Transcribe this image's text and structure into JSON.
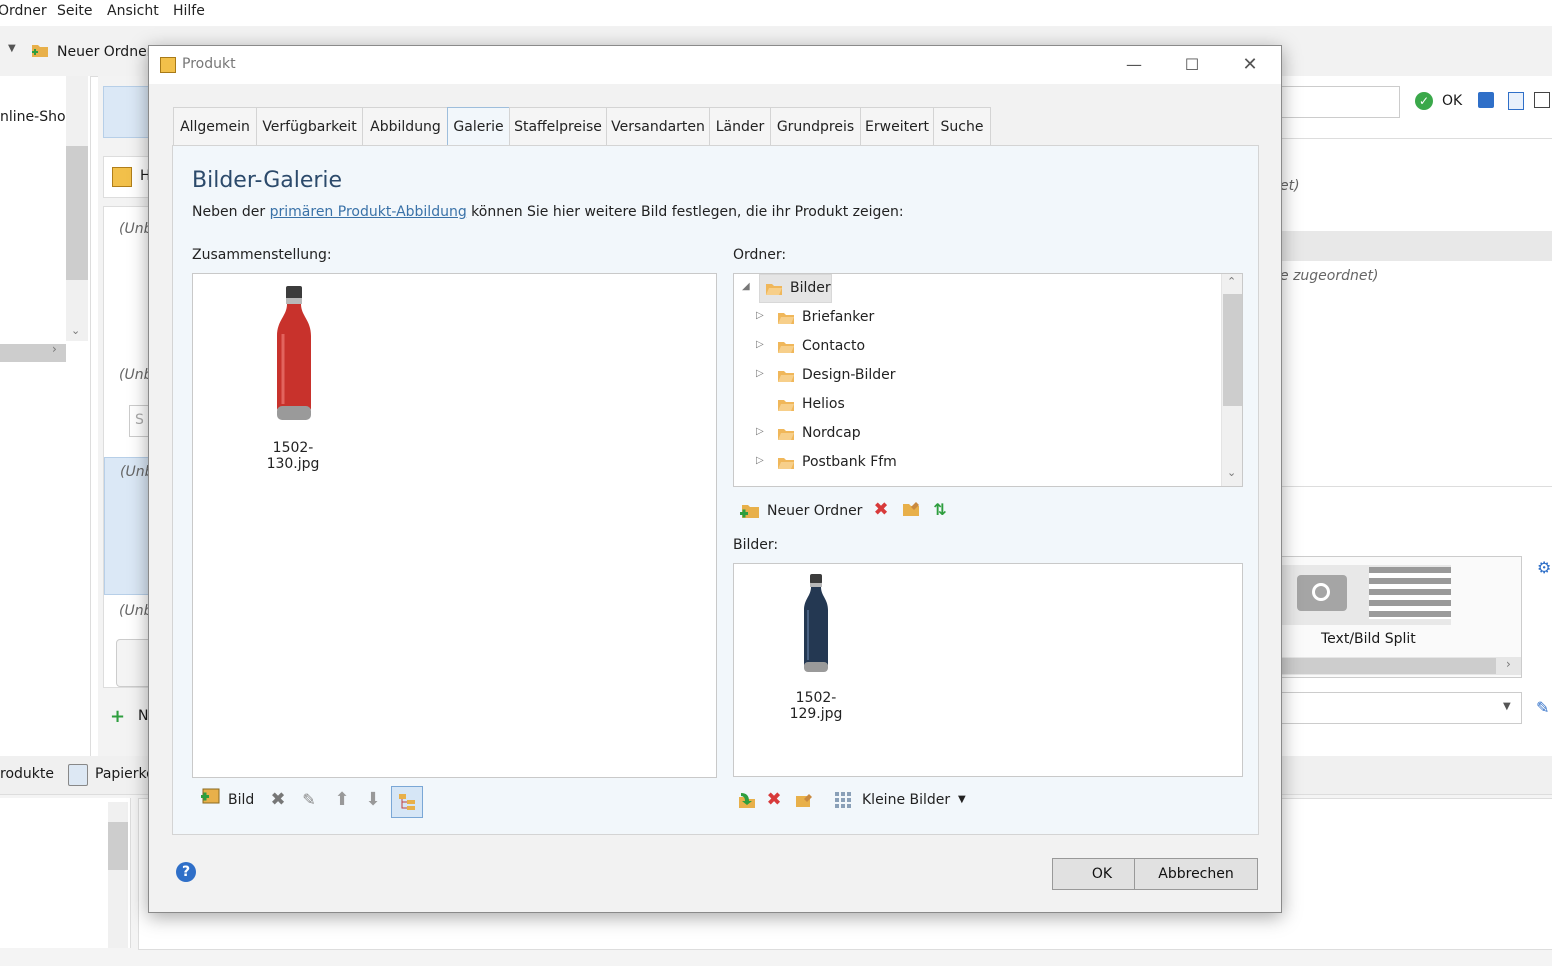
{
  "menu": [
    "Ordner",
    "Seite",
    "Ansicht",
    "Hilfe"
  ],
  "bg": {
    "new_folder": "Neuer Ordner",
    "shop": "nline-Shop",
    "unb": "(Unb",
    "side_h": "H",
    "ok": "OK",
    "right_hint1": "et)",
    "right_hint2": "e zugeordnet)",
    "text_bild_split": "Text/Bild Split",
    "produkte": "rodukte",
    "papierkorb": "Papierko",
    "n_item": "N",
    "search_s": "S"
  },
  "dialog": {
    "title": "Produkt",
    "tabs": [
      "Allgemein",
      "Verfügbarkeit",
      "Abbildung",
      "Galerie",
      "Staffelpreise",
      "Versandarten",
      "Länder",
      "Grundpreis",
      "Erweitert",
      "Suche"
    ],
    "active_tab": "Galerie",
    "heading": "Bilder-Galerie",
    "desc_before": "Neben der ",
    "desc_link": "primären Produkt-Abbildung",
    "desc_after": " können Sie hier weitere Bild festlegen, die ihr Produkt zeigen:",
    "composition_label": "Zusammenstellung:",
    "composition_items": [
      {
        "name": "1502-130.jpg",
        "color": "#c8322c"
      }
    ],
    "folder_label": "Ordner:",
    "tree": [
      {
        "name": "Bilder",
        "level": 0,
        "expanded": true,
        "selected": true
      },
      {
        "name": "Briefanker",
        "level": 1,
        "has_children": true
      },
      {
        "name": "Contacto",
        "level": 1,
        "has_children": true
      },
      {
        "name": "Design-Bilder",
        "level": 1,
        "has_children": true
      },
      {
        "name": "Helios",
        "level": 1,
        "has_children": false
      },
      {
        "name": "Nordcap",
        "level": 1,
        "has_children": true
      },
      {
        "name": "Postbank Ffm",
        "level": 1,
        "has_children": true
      }
    ],
    "new_folder_label": "Neuer Ordner",
    "images_label": "Bilder:",
    "images": [
      {
        "name": "1502-129.jpg",
        "color": "#243852"
      }
    ],
    "add_image_label": "Bild",
    "view_mode": "Kleine Bilder",
    "ok_label": "OK",
    "cancel_label": "Abbrechen"
  }
}
